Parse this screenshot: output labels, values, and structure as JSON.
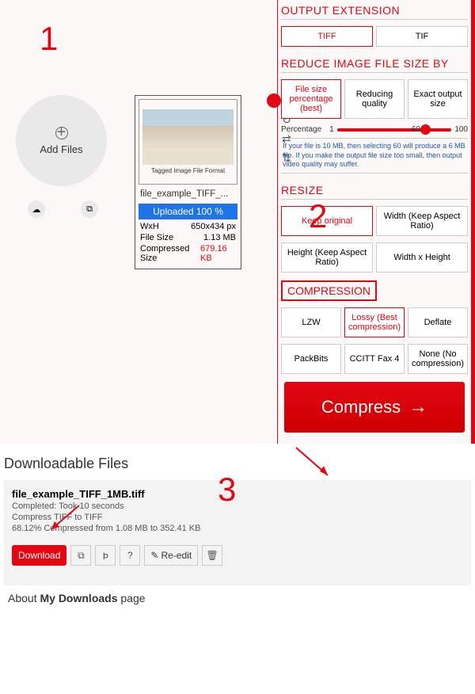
{
  "steps": {
    "one": "1",
    "two": "2",
    "three": "3"
  },
  "addFiles": {
    "label": "Add Files"
  },
  "fileCard": {
    "thumbCaption": "Tagged Image File Format",
    "name": "file_example_TIFF_...",
    "uploadStatus": "Uploaded 100 %",
    "wxhLabel": "WxH",
    "wxh": "650x434 px",
    "sizeLabel": "File Size",
    "size": "1.13 MB",
    "compLabel": "Compressed Size",
    "compSize": "679.16 KB"
  },
  "outputExt": {
    "header": "OUTPUT EXTENSION",
    "opts": [
      "TIFF",
      "TIF"
    ]
  },
  "reduce": {
    "header": "REDUCE IMAGE FILE SIZE BY",
    "opts": [
      "File size percentage (best)",
      "Reducing quality",
      "Exact output size"
    ],
    "percentLabel": "Percentage",
    "ticks": [
      "1",
      "60",
      "100"
    ],
    "help": "If your file is 10 MB, then selecting 60 will produce a 6 MB file. If you make the output file size too small, then output video quality may suffer."
  },
  "resize": {
    "header": "RESIZE",
    "opts": [
      "Keep original",
      "Width (Keep Aspect Ratio)",
      "Height (Keep Aspect Ratio)",
      "Width x Height"
    ]
  },
  "compression": {
    "header": "COMPRESSION",
    "opts": [
      "LZW",
      "Lossy (Best compression)",
      "Deflate",
      "PackBits",
      "CCITT Fax 4",
      "None (No compression)"
    ]
  },
  "compressBtn": "Compress",
  "downloadable": {
    "header": "Downloadable Files",
    "filename": "file_example_TIFF_1MB.tiff",
    "completed": "Completed: Took 10 seconds",
    "action": "Compress TIFF to TIFF",
    "stats": "68.12% Compressed from 1.08 MB to 352.41 KB",
    "downloadBtn": "Download",
    "reeditBtn": "Re-edit"
  },
  "about": {
    "prefix": "About ",
    "bold": "My Downloads",
    "suffix": " page"
  }
}
